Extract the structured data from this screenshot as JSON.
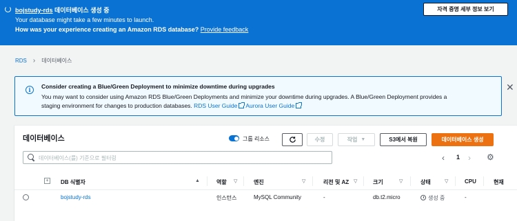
{
  "flash": {
    "db_name": "bojstudy-rds",
    "title_suffix": " 데이터베이스 생성 중",
    "line2": "Your database might take a few minutes to launch.",
    "line3": "How was your experience creating an Amazon RDS database?",
    "feedback_link": "Provide feedback",
    "credentials_button": "자격 증명 세부 정보 보기",
    "background_color": "#0972d3"
  },
  "breadcrumb": {
    "root": "RDS",
    "current": "데이터베이스"
  },
  "alert": {
    "title": "Consider creating a Blue/Green Deployment to minimize downtime during upgrades",
    "body_line1": "You may want to consider using Amazon RDS Blue/Green Deployments and minimize your downtime during upgrades. A Blue/Green Deployment provides a",
    "body_line2": "staging environment for changes to production databases.",
    "link1": "RDS User Guide",
    "link2": "Aurora User Guide",
    "icon": "info-icon"
  },
  "panel": {
    "title": "데이터베이스",
    "toggle_label": "그룹 리소스",
    "toggle_on": true,
    "edit_button": "수정",
    "actions_button": "작업",
    "restore_button": "S3에서 복원",
    "create_button": "데이터베이스 생성",
    "accent_color": "#ec7211",
    "search_placeholder": "데이터베이스(를) 기준으로 필터링",
    "current_page": "1"
  },
  "table": {
    "columns": [
      "DB 식별자",
      "역할",
      "엔진",
      "리전 및 AZ",
      "크기",
      "상태",
      "CPU",
      "현재"
    ],
    "rows": [
      {
        "id": "bojstudy-rds",
        "role": "인스턴스",
        "engine": "MySQL Community",
        "region": "-",
        "size": "db.t2.micro",
        "status": "생성 중",
        "cpu": "-"
      }
    ]
  }
}
